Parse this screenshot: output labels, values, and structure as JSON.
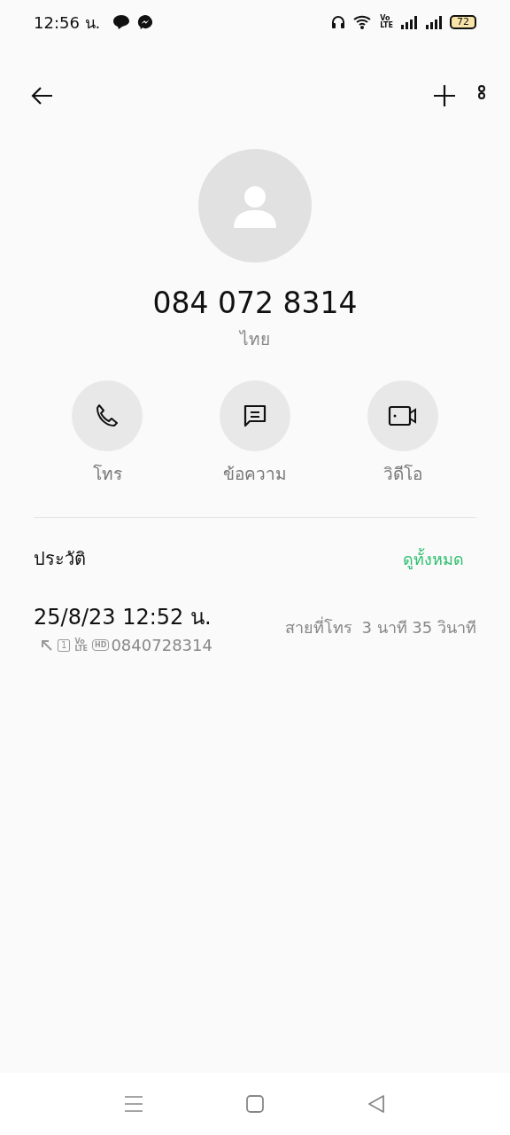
{
  "status_bar": {
    "time": "12:56 น.",
    "volte": [
      "Vo",
      "LTE"
    ],
    "battery": "72"
  },
  "contact": {
    "number": "084 072 8314",
    "location": "ไทย"
  },
  "actions": [
    {
      "kind": "call",
      "label": "โทร"
    },
    {
      "kind": "message",
      "label": "ข้อความ"
    },
    {
      "kind": "video",
      "label": "วิดีโอ"
    }
  ],
  "history": {
    "title": "ประวัติ",
    "see_all": "ดูทั้งหมด",
    "entries": [
      {
        "datetime": "25/8/23 12:52 น.",
        "sim": "1",
        "volte": [
          "Vo",
          "LTE"
        ],
        "hd": "HD",
        "number": "0840728314",
        "type": "สายที่โทร",
        "duration": "3 นาที 35 วินาที"
      }
    ]
  }
}
